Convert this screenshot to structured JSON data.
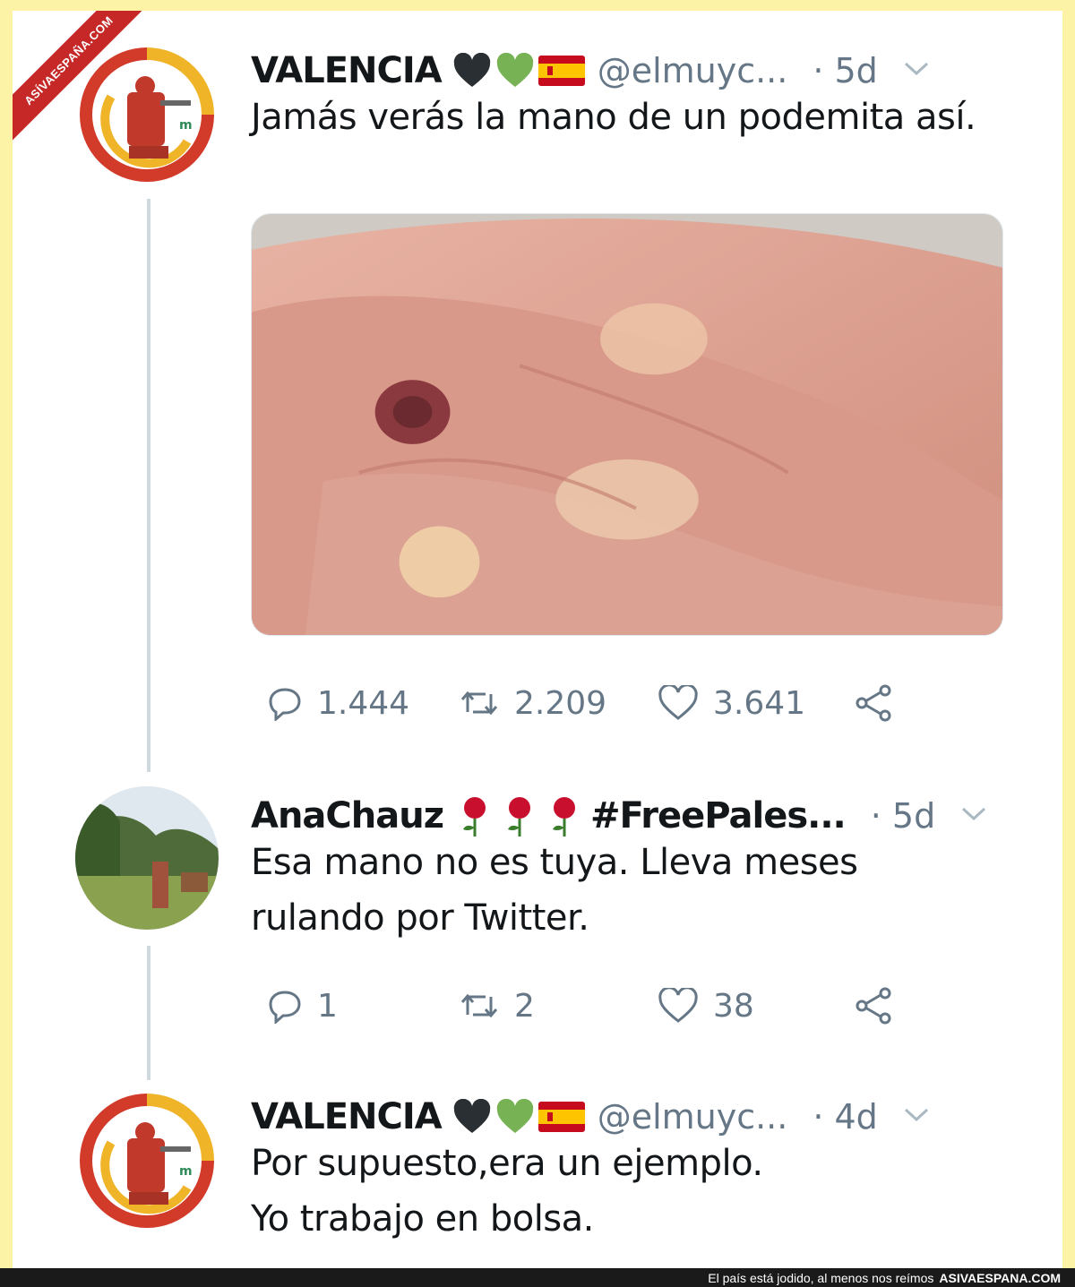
{
  "watermark": {
    "ribbon": "ASÍVAESPAÑA.COM"
  },
  "tweets": [
    {
      "name": "VALENCIA",
      "handle": "@elmuyc...",
      "time": "· 5d",
      "text": "Jamás verás la mano de un podemita así.",
      "stats": {
        "replies": "1.444",
        "retweets": "2.209",
        "likes": "3.641"
      }
    },
    {
      "name": "AnaChauz",
      "handle": "#FreePales...",
      "time": "· 5d",
      "text": "Esa mano no es tuya. Lleva meses rulando por Twitter.",
      "stats": {
        "replies": "1",
        "retweets": "2",
        "likes": "38"
      }
    },
    {
      "name": "VALENCIA",
      "handle": "@elmuyc...",
      "time": "· 4d",
      "text_line1": "Por supuesto,era un ejemplo.",
      "text_line2": "Yo trabajo en bolsa."
    }
  ],
  "footer": {
    "caption": "El país está jodido, al menos nos reímos",
    "site": "ASIVAESPANA.COM"
  },
  "icons": [
    "reply-icon",
    "retweet-icon",
    "like-icon",
    "share-icon",
    "chevron-down-icon",
    "black-heart-icon",
    "green-heart-icon",
    "spain-flag-icon",
    "rose-icon"
  ]
}
